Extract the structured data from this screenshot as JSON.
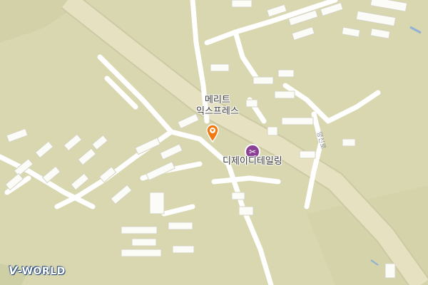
{
  "map": {
    "places": [
      {
        "id": "merit",
        "lines": [
          "메리트",
          "익스프레스"
        ]
      },
      {
        "id": "dj",
        "lines": [
          "디제이디테일링"
        ]
      }
    ],
    "road_name": "양신로",
    "brand": {
      "prefix": "V",
      "suffix": "-WORLD"
    },
    "colors": {
      "land": "#d8d7b0",
      "road_major": "#e8e3c2",
      "road_minor": "#ffffff",
      "building": "#fafafa",
      "poi": "#8b3f95",
      "marker": "#f2790f",
      "water": "#8fb0d8"
    }
  }
}
